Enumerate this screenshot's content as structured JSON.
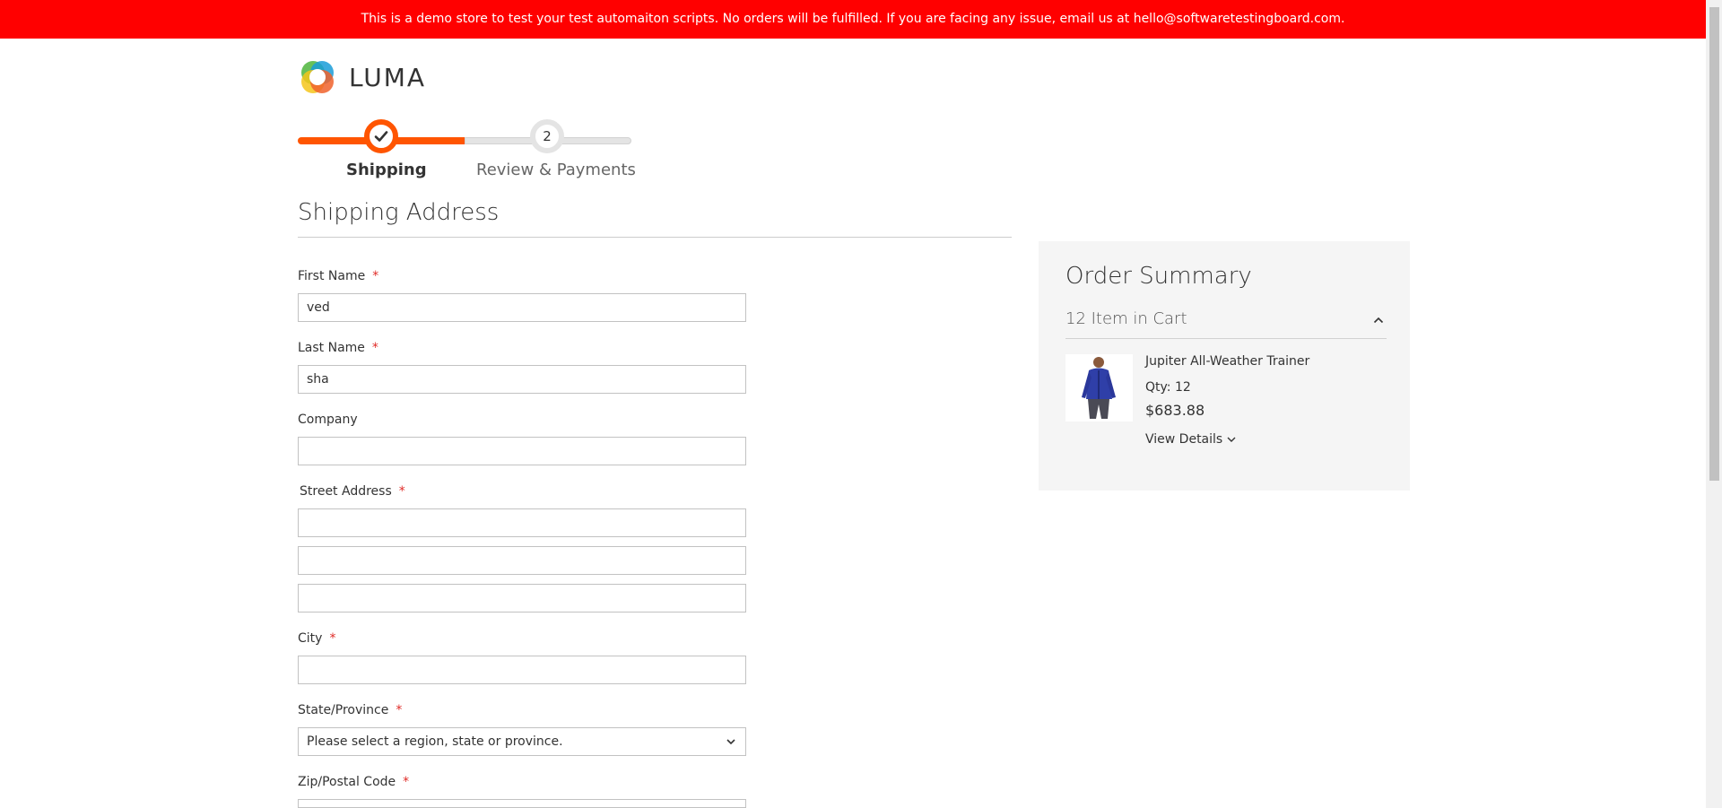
{
  "banner": {
    "text": "This is a demo store to test your test automaiton scripts. No orders will be fulfilled. If you are facing any issue, email us at hello@softwaretestingboard.com."
  },
  "logo": {
    "text": "LUMA"
  },
  "progress": {
    "steps": [
      {
        "label": "Shipping",
        "state": "complete"
      },
      {
        "number": "2",
        "label": "Review & Payments",
        "state": "pending"
      }
    ]
  },
  "shipping": {
    "title": "Shipping Address",
    "fields": {
      "first_name": {
        "label": "First Name",
        "value": "ved",
        "required": "*"
      },
      "last_name": {
        "label": "Last Name",
        "value": "sha",
        "required": "*"
      },
      "company": {
        "label": "Company",
        "value": ""
      },
      "street": {
        "label": "Street Address",
        "required": "*",
        "line1": "",
        "line2": "",
        "line3": ""
      },
      "city": {
        "label": "City",
        "value": "",
        "required": "*"
      },
      "state": {
        "label": "State/Province",
        "value": "Please select a region, state or province.",
        "required": "*"
      },
      "zip": {
        "label": "Zip/Postal Code",
        "value": "",
        "required": "*"
      }
    }
  },
  "summary": {
    "title": "Order Summary",
    "cart_count": "12 Item in Cart",
    "item": {
      "name": "Jupiter All-Weather Trainer",
      "qty": "Qty: 12",
      "price": "$683.88",
      "details_label": "View Details"
    }
  },
  "colors": {
    "banner": "#ff0000",
    "accent": "#ff5501",
    "required": "#e02b27",
    "summary_bg": "#f5f5f5"
  }
}
